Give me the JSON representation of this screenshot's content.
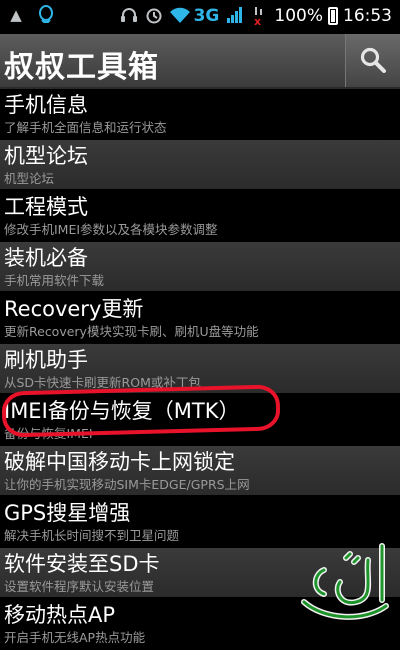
{
  "status_bar": {
    "network": "3G",
    "battery_percent": "100%",
    "time": "16:53",
    "icons": [
      "warning-icon",
      "notification-icon",
      "headset-icon",
      "alarm-icon",
      "wifi-icon",
      "signal-icon",
      "no-sim-icon",
      "battery-icon"
    ]
  },
  "header": {
    "title": "叔叔工具箱",
    "search_icon": "search-icon"
  },
  "menu": {
    "items": [
      {
        "title": "手机信息",
        "subtitle": "了解手机全面信息和运行状态"
      },
      {
        "title": "机型论坛",
        "subtitle": "机型论坛"
      },
      {
        "title": "工程模式",
        "subtitle": "修改手机IMEI参数以及各模块参数调整"
      },
      {
        "title": "装机必备",
        "subtitle": "手机常用软件下载"
      },
      {
        "title": "Recovery更新",
        "subtitle": "更新Recovery模块实现卡刷、刷机U盘等功能"
      },
      {
        "title": "刷机助手",
        "subtitle": "从SD卡快速卡刷更新ROM或补丁包"
      },
      {
        "title": "IMEI备份与恢复（MTK）",
        "subtitle": "备份与恢复IMEI"
      },
      {
        "title": "破解中国移动卡上网锁定",
        "subtitle": "让你的手机实现移动SIM卡EDGE/GPRS上网"
      },
      {
        "title": "GPS搜星增强",
        "subtitle": "解决手机长时间搜不到卫星问题"
      },
      {
        "title": "软件安装至SD卡",
        "subtitle": "设置软件程序默认安装位置"
      },
      {
        "title": "移动热点AP",
        "subtitle": "开启手机无线AP热点功能"
      }
    ]
  },
  "colors": {
    "accent_blue": "#2fb6e8",
    "annotation_red": "#e8132a",
    "watermark_green": "#1f9b2d"
  }
}
